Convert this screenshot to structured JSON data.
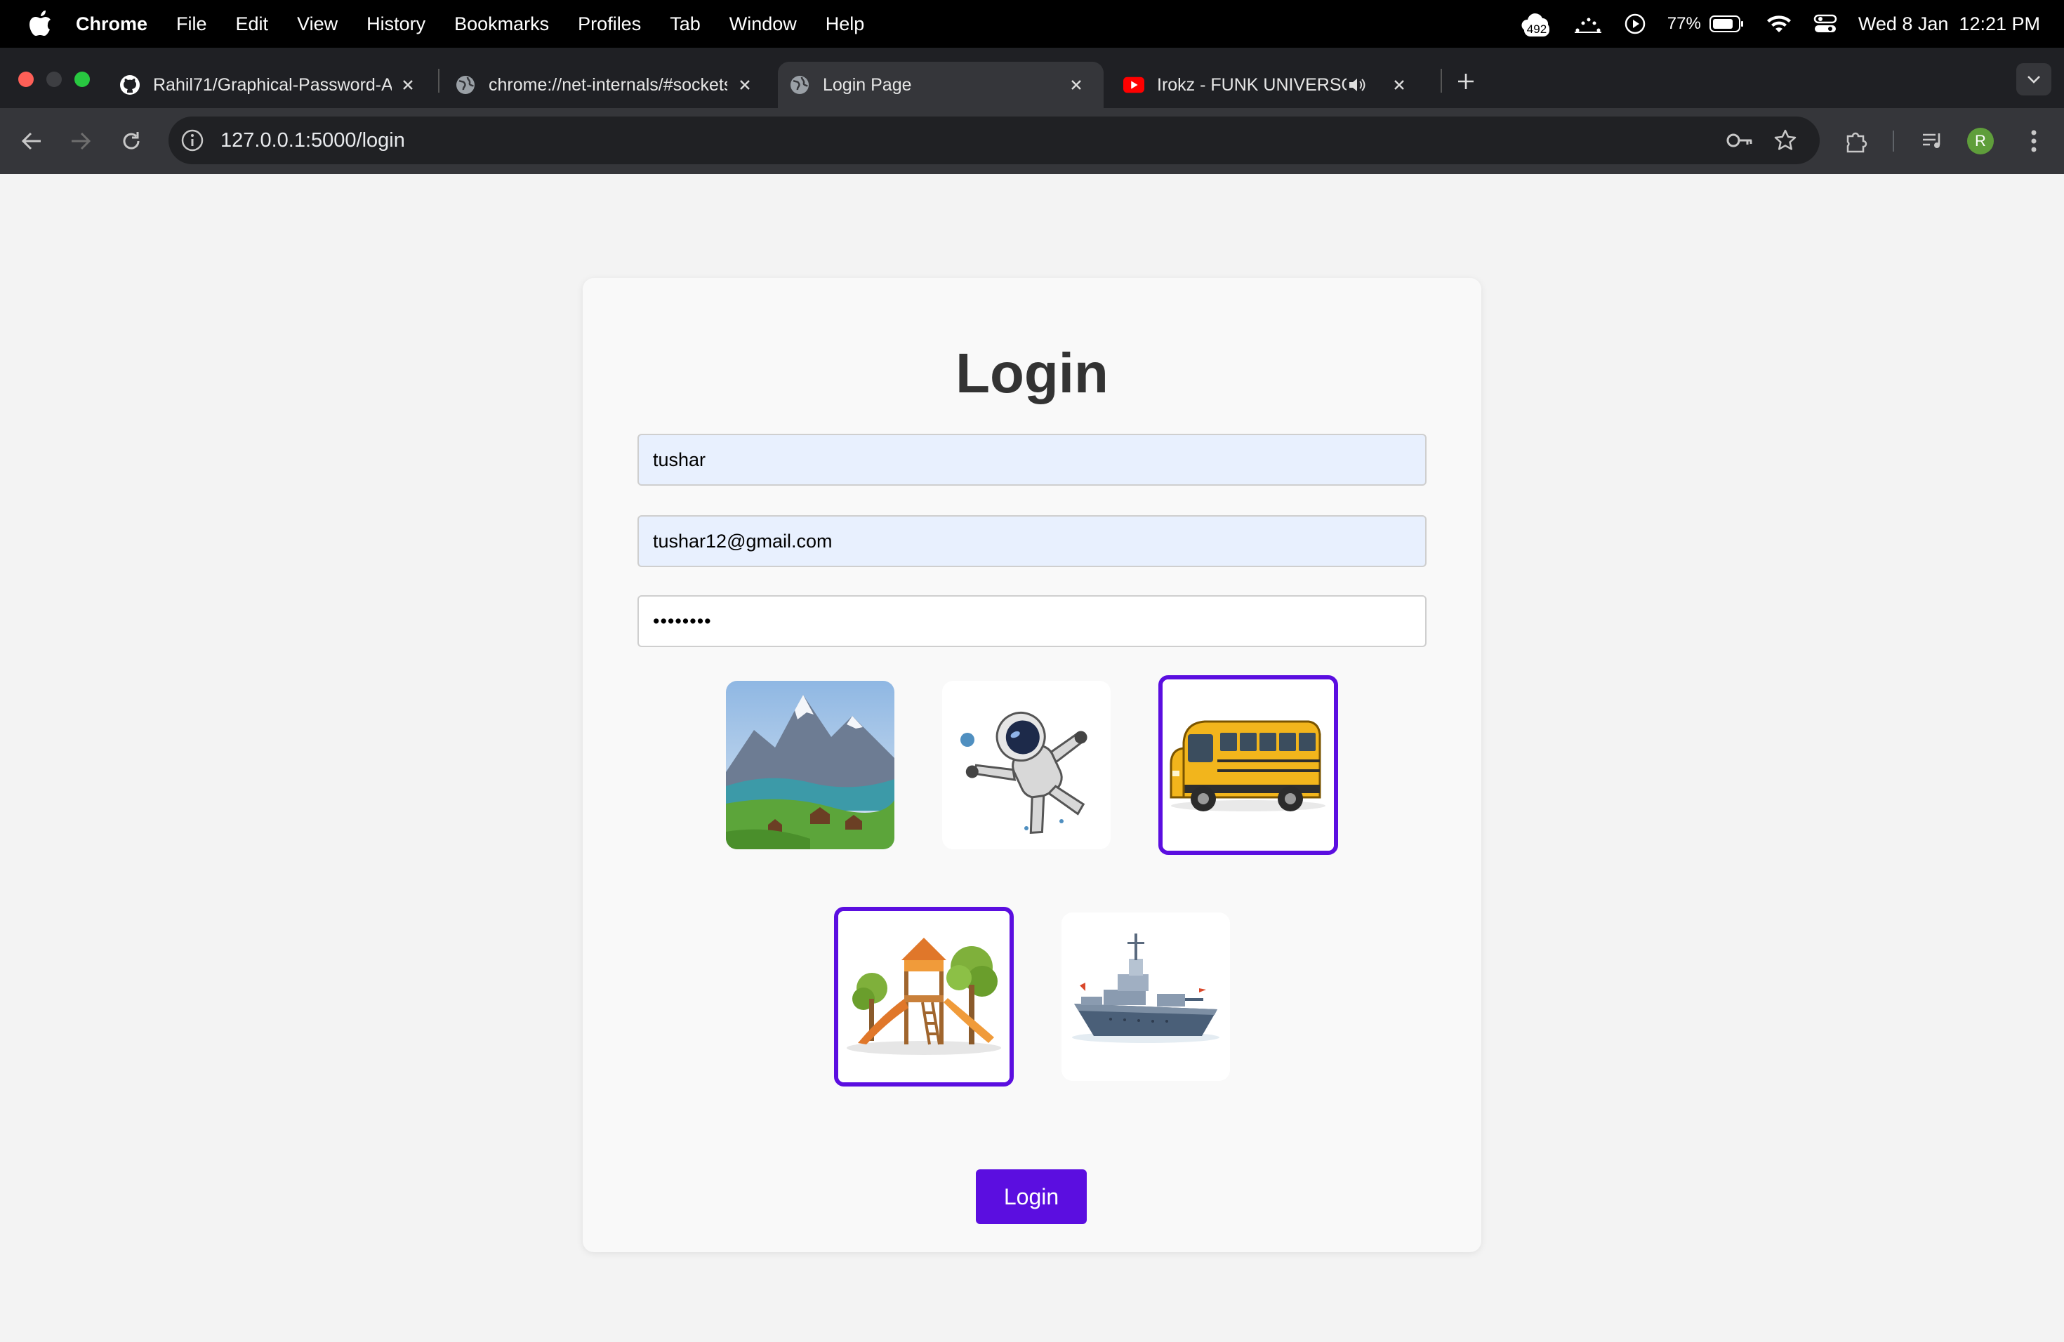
{
  "menubar": {
    "app": "Chrome",
    "items": [
      "File",
      "Edit",
      "View",
      "History",
      "Bookmarks",
      "Profiles",
      "Tab",
      "Window",
      "Help"
    ],
    "badge": "492",
    "battery": "77%",
    "datetime": "Wed 8 Jan  12:21 PM"
  },
  "tabs": [
    {
      "title": "Rahil71/Graphical-Password-A",
      "icon": "github-icon"
    },
    {
      "title": "chrome://net-internals/#sockets",
      "icon": "globe-icon"
    },
    {
      "title": "Login Page",
      "icon": "globe-icon",
      "active": true
    },
    {
      "title": "Irokz - FUNK UNIVERSO - Yo",
      "icon": "youtube-icon",
      "audio": true
    }
  ],
  "toolbar": {
    "url": "127.0.0.1:5000/login",
    "profile_initial": "R"
  },
  "login": {
    "heading": "Login",
    "username": "tushar",
    "email": "tushar12@gmail.com",
    "password": "••••••••",
    "button": "Login"
  },
  "images": [
    {
      "name": "mountain-lake",
      "selected": false
    },
    {
      "name": "astronaut",
      "selected": false
    },
    {
      "name": "school-bus",
      "selected": true
    },
    {
      "name": "playground",
      "selected": true
    },
    {
      "name": "battleship",
      "selected": false
    }
  ],
  "colors": {
    "accent": "#5b0ee0",
    "autofill": "#e8f0fe"
  }
}
